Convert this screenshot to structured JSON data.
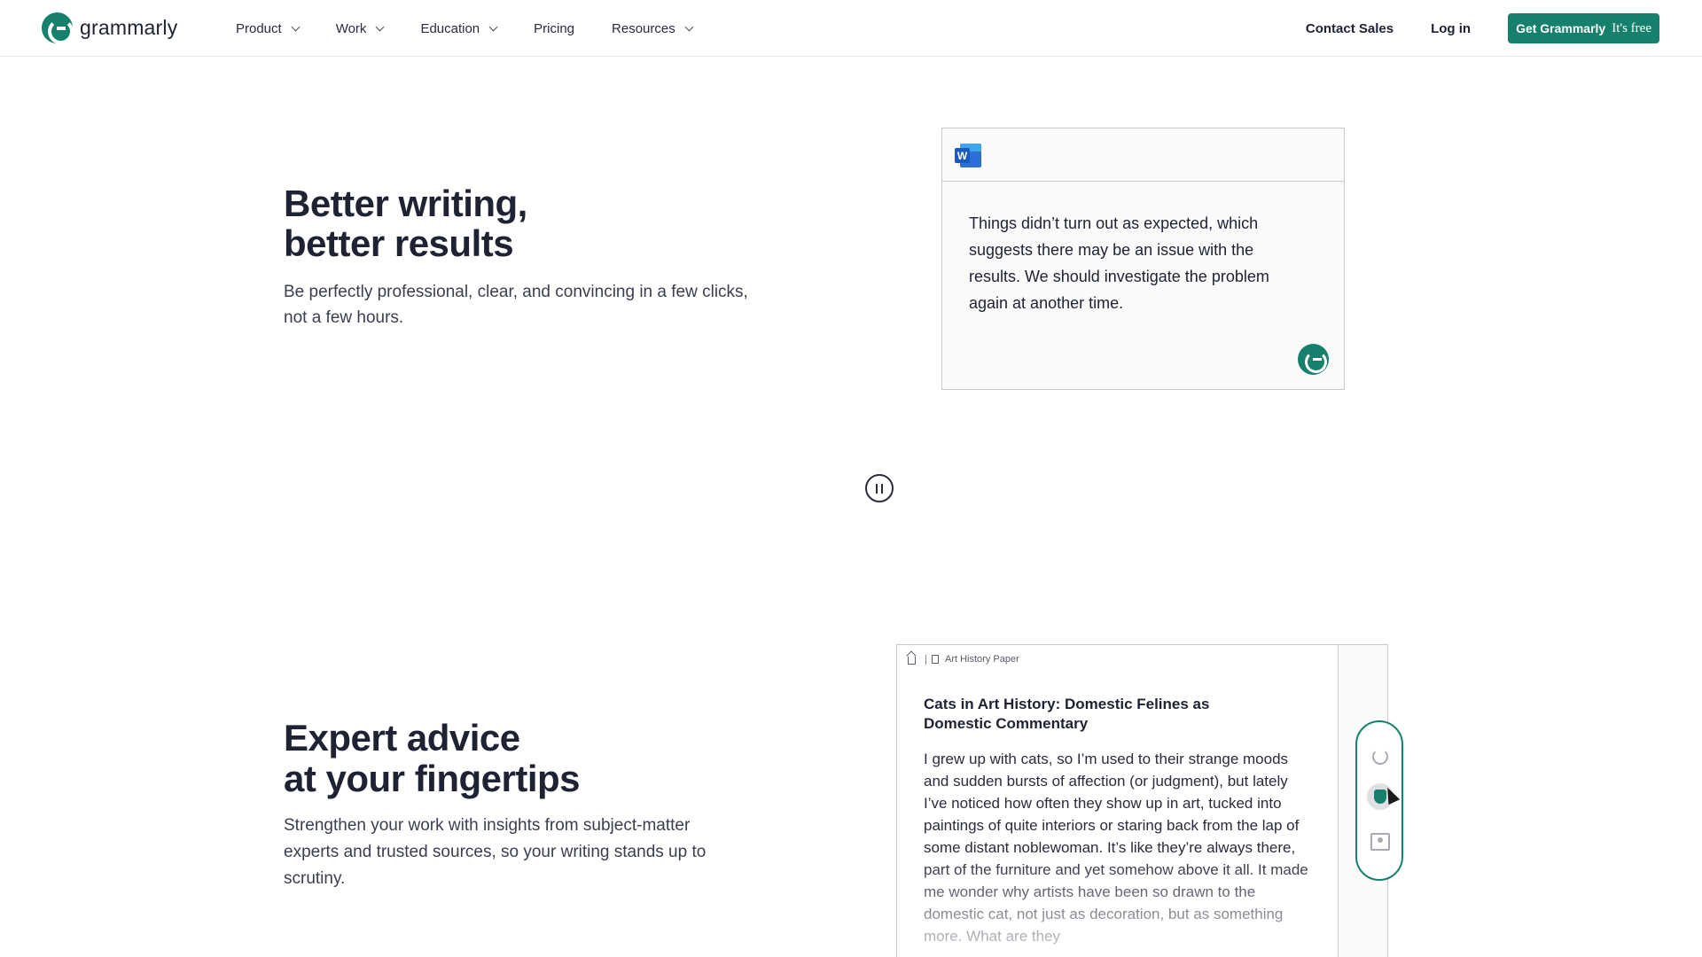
{
  "nav": {
    "logo_text": "grammarly",
    "items": [
      {
        "label": "Product",
        "has_dropdown": true
      },
      {
        "label": "Work",
        "has_dropdown": true
      },
      {
        "label": "Education",
        "has_dropdown": true
      },
      {
        "label": "Pricing",
        "has_dropdown": false
      },
      {
        "label": "Resources",
        "has_dropdown": true
      }
    ],
    "contact_sales": "Contact Sales",
    "login": "Log in",
    "cta_main": "Get Grammarly",
    "cta_free": "It's free"
  },
  "section1": {
    "title_line1": "Better writing,",
    "title_line2": "better results",
    "subtitle_line1": "Be perfectly professional, clear, and convincing in a few clicks,",
    "subtitle_line2": "not a few hours.",
    "card_app_icon": "word-icon",
    "card_text": "Things didn’t turn out as expected, which suggests there may be an issue with the results. We should investigate the problem again at another time."
  },
  "pause_icon": "pause-icon",
  "section2": {
    "title_line1": "Expert advice",
    "title_line2": "at your fingertips",
    "subtitle_line1": "Strengthen your work with insights from subject-matter",
    "subtitle_line2": "experts and trusted sources, so your writing stands up to",
    "subtitle_line3": "scrutiny.",
    "doc_breadcrumb": "Art History Paper",
    "doc_title": "Cats in Art History: Domestic Felines as Domestic Commentary",
    "doc_body": "I grew up with cats, so I’m used to their strange moods and sudden bursts of affection (or judgment), but lately I’ve noticed how often they show up in art, tucked into paintings of quite interiors or staring back from the lap of some distant noblewoman. It’s like they’re always there, part of the furniture and yet somehow above it all. It made me wonder why artists have been so drawn to the domestic cat, not just as decoration, but as something more. What are they"
  },
  "colors": {
    "brand": "#15806b",
    "text": "#1f2233"
  }
}
